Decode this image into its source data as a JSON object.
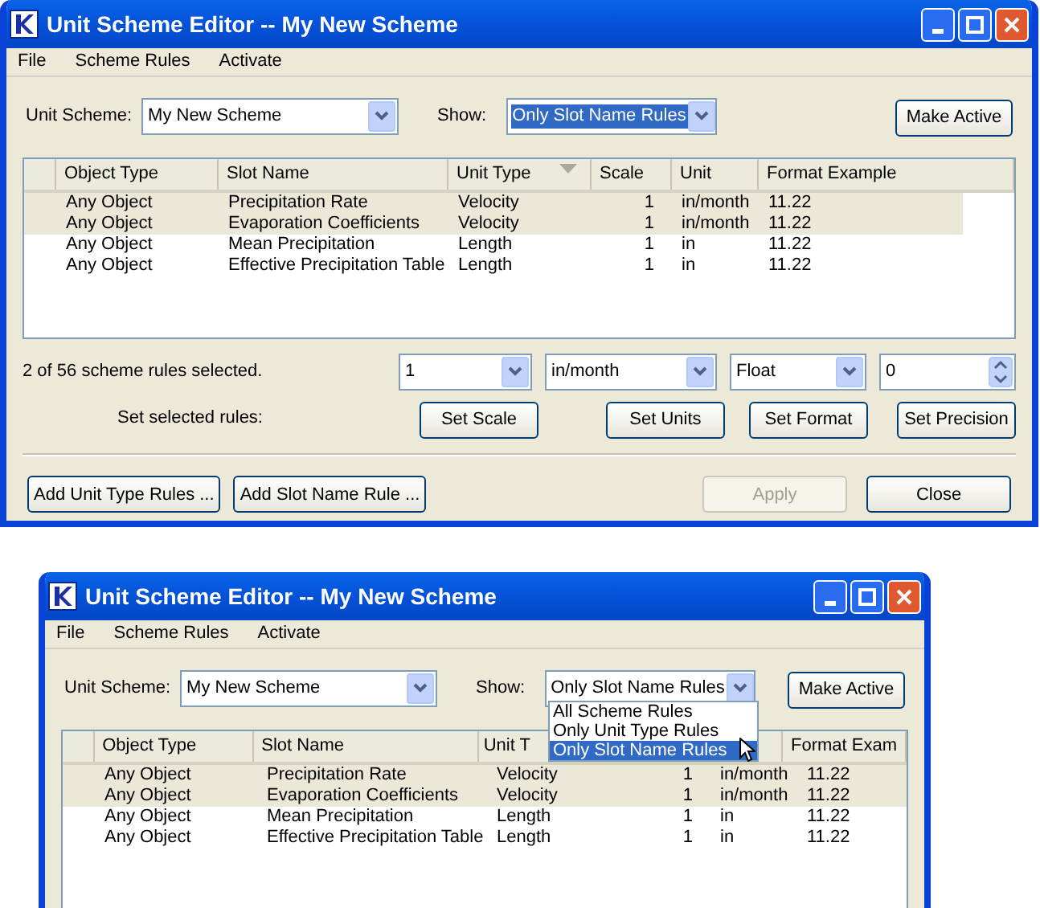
{
  "windows": [
    {
      "title": "Unit Scheme Editor -- My New Scheme",
      "menu": [
        "File",
        "Scheme Rules",
        "Activate"
      ],
      "scheme": {
        "label": "Unit Scheme:",
        "value": "My New Scheme"
      },
      "show": {
        "label": "Show:",
        "value": "Only Slot Name Rules",
        "focused": true
      },
      "make_active": "Make Active",
      "columns": [
        {
          "label": "Object Type"
        },
        {
          "label": "Slot Name"
        },
        {
          "label": "Unit Type",
          "sorted": true
        },
        {
          "label": "Scale"
        },
        {
          "label": "Unit"
        },
        {
          "label": "Format Example"
        }
      ],
      "rows": [
        {
          "selected": true,
          "cells": [
            "Any Object",
            "Precipitation Rate",
            "Velocity",
            "1",
            "in/month",
            "11.22"
          ]
        },
        {
          "selected": true,
          "cells": [
            "Any Object",
            "Evaporation Coefficients",
            "Velocity",
            "1",
            "in/month",
            "11.22"
          ]
        },
        {
          "selected": false,
          "cells": [
            "Any Object",
            "Mean Precipitation",
            "Length",
            "1",
            "in",
            "11.22"
          ]
        },
        {
          "selected": false,
          "cells": [
            "Any Object",
            "Effective Precipitation Table",
            "Length",
            "1",
            "in",
            "11.22"
          ]
        }
      ],
      "status": "2 of 56 scheme rules selected.",
      "editors": [
        {
          "kind": "combo",
          "value": "1"
        },
        {
          "kind": "combo",
          "value": "in/month"
        },
        {
          "kind": "combo",
          "value": "Float"
        },
        {
          "kind": "spinner",
          "value": "0"
        }
      ],
      "set_label": "Set selected rules:",
      "set_buttons": [
        "Set Scale",
        "Set Units",
        "Set Format",
        "Set Precision"
      ],
      "footer_buttons": [
        {
          "label": "Add Unit Type Rules ...",
          "disabled": false
        },
        {
          "label": "Add Slot Name Rule ...",
          "disabled": false
        },
        {
          "label": "Apply",
          "disabled": true
        },
        {
          "label": "Close",
          "disabled": false
        }
      ]
    },
    {
      "title": "Unit Scheme Editor -- My New Scheme",
      "menu": [
        "File",
        "Scheme Rules",
        "Activate"
      ],
      "scheme": {
        "label": "Unit Scheme:",
        "value": "My New Scheme"
      },
      "show": {
        "label": "Show:",
        "value": "Only Slot Name Rules",
        "focused": false,
        "options": [
          {
            "label": "All Scheme Rules",
            "selected": false
          },
          {
            "label": "Only Unit Type Rules",
            "selected": false
          },
          {
            "label": "Only Slot Name Rules",
            "selected": true
          }
        ]
      },
      "make_active": "Make Active",
      "columns": [
        {
          "label": "Object Type"
        },
        {
          "label": "Slot Name"
        },
        {
          "label": "Unit T",
          "sorted": false
        },
        {},
        {},
        {
          "label": "Format Exam"
        }
      ],
      "rows": [
        {
          "selected": true,
          "cells": [
            "Any Object",
            "Precipitation Rate",
            "Velocity",
            "1",
            "in/month",
            "11.22"
          ]
        },
        {
          "selected": true,
          "cells": [
            "Any Object",
            "Evaporation Coefficients",
            "Velocity",
            "1",
            "in/month",
            "11.22"
          ]
        },
        {
          "selected": false,
          "cells": [
            "Any Object",
            "Mean Precipitation",
            "Length",
            "1",
            "in",
            "11.22"
          ]
        },
        {
          "selected": false,
          "cells": [
            "Any Object",
            "Effective Precipitation Table",
            "Length",
            "1",
            "in",
            "11.22"
          ]
        }
      ]
    }
  ]
}
